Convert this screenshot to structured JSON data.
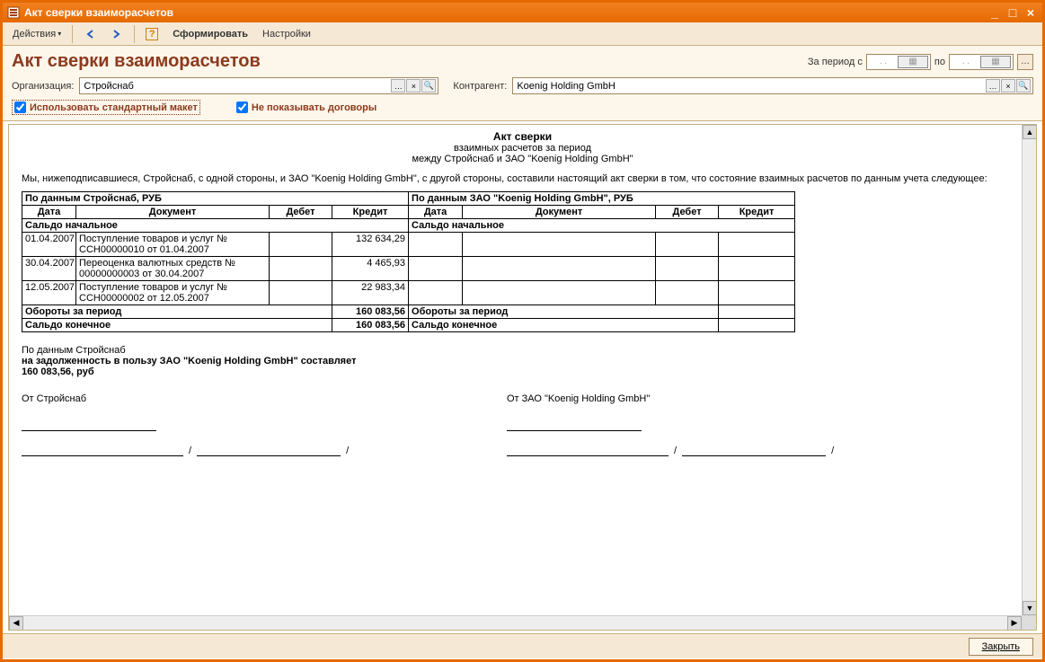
{
  "window": {
    "title": "Акт сверки взаиморасчетов"
  },
  "toolbar": {
    "actions": "Действия",
    "form": "Сформировать",
    "settings": "Настройки"
  },
  "header": {
    "doc_title": "Акт сверки взаиморасчетов",
    "period_label": "За период с",
    "period_to": "по",
    "date_placeholder": ".  .",
    "org_label": "Организация:",
    "org_value": "Стройснаб",
    "contr_label": "Контрагент:",
    "contr_value": "Koenig Holding GmbH",
    "chk1": "Использовать стандартный макет",
    "chk2": "Не показывать договоры"
  },
  "report": {
    "title": "Акт сверки",
    "subtitle": "взаимных расчетов за период",
    "between": "между Стройснаб и ЗАО \"Koenig Holding GmbH\"",
    "preamble": "Мы, нижеподписавшиеся, Стройснаб, с одной стороны, и ЗАО \"Koenig Holding GmbH\", с другой стороны, составили настоящий акт сверки в том, что состояние взаимных расчетов по данным учета следующее:",
    "left_header": "По данным Стройснаб, РУБ",
    "right_header": "По данным ЗАО \"Koenig Holding GmbH\", РУБ",
    "col_date": "Дата",
    "col_doc": "Документ",
    "col_debit": "Дебет",
    "col_credit": "Кредит",
    "saldo_start": "Сальдо начальное",
    "rows": [
      {
        "date": "01.04.2007",
        "doc": "Поступление товаров и услуг № ССН00000010 от 01.04.2007",
        "debit": "",
        "credit": "132 634,29"
      },
      {
        "date": "30.04.2007",
        "doc": "Переоценка валютных средств № 00000000003 от 30.04.2007",
        "debit": "",
        "credit": "4 465,93"
      },
      {
        "date": "12.05.2007",
        "doc": "Поступление товаров и услуг № ССН00000002 от 12.05.2007",
        "debit": "",
        "credit": "22 983,34"
      }
    ],
    "turnover": "Обороты за период",
    "turnover_credit": "160 083,56",
    "saldo_end": "Сальдо конечное",
    "saldo_end_credit": "160 083,56",
    "summary1": "По данным Стройснаб",
    "summary2": "на   задолженность в пользу ЗАО \"Koenig Holding GmbH\" составляет",
    "summary3": "160 083,56, руб",
    "sig_from_left": "От Стройснаб",
    "sig_from_right": "От ЗАО \"Koenig Holding GmbH\""
  },
  "footer": {
    "close": "Закрыть"
  }
}
